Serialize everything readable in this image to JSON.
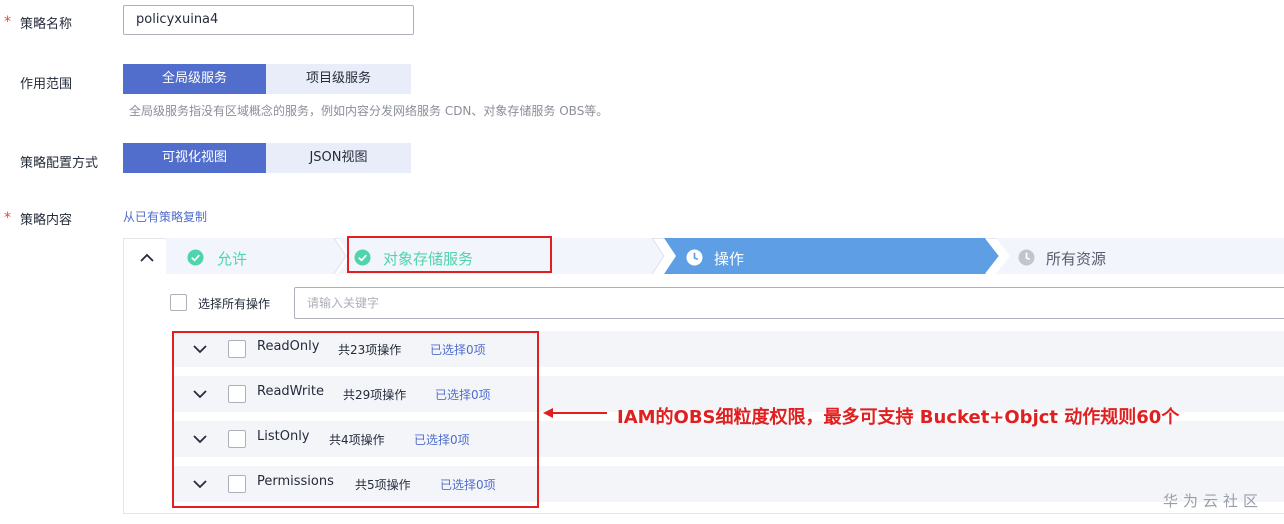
{
  "form": {
    "policy_name_label": "策略名称",
    "policy_name_value": "policyxuina4",
    "scope_label": "作用范围",
    "scope_options": [
      "全局级服务",
      "项目级服务"
    ],
    "scope_selected": "全局级服务",
    "scope_hint": "全局级服务指没有区域概念的服务，例如内容分发网络服务 CDN、对象存储服务 OBS等。",
    "config_mode_label": "策略配置方式",
    "config_mode_options": [
      "可视化视图",
      "JSON视图"
    ],
    "config_mode_selected": "可视化视图",
    "content_label": "策略内容",
    "copy_link": "从已有策略复制",
    "required_mark": "*"
  },
  "steps": [
    {
      "label": "允许",
      "status": "done"
    },
    {
      "label": "对象存储服务",
      "status": "done"
    },
    {
      "label": "操作",
      "status": "active"
    },
    {
      "label": "所有资源",
      "status": "pending"
    }
  ],
  "actions": {
    "select_all_label": "选择所有操作",
    "search_placeholder": "请输入关键字",
    "groups": [
      {
        "name": "ReadOnly",
        "count": "共23项操作",
        "selected": "已选择0项"
      },
      {
        "name": "ReadWrite",
        "count": "共29项操作",
        "selected": "已选择0项"
      },
      {
        "name": "ListOnly",
        "count": "共4项操作",
        "selected": "已选择0项"
      },
      {
        "name": "Permissions",
        "count": "共5项操作",
        "selected": "已选择0项"
      }
    ]
  },
  "annotation": {
    "text": "IAM的OBS细粒度权限，最多可支持 Bucket+Objct 动作规则60个"
  },
  "watermark": "华为云社区",
  "colors": {
    "primary": "#526ecc",
    "primary_light": "#e9edfa",
    "success": "#50d4ab",
    "step_active": "#5e9ee5",
    "step_pending": "#f2f5fc",
    "annotation_red": "#e02020",
    "required_red": "#e54545"
  },
  "icons": {
    "step_done": "check-circle-icon",
    "step_active": "clock-icon",
    "step_pending": "clock-icon",
    "panel_toggle": "chevron-up-icon",
    "group_toggle": "chevron-down-icon"
  }
}
